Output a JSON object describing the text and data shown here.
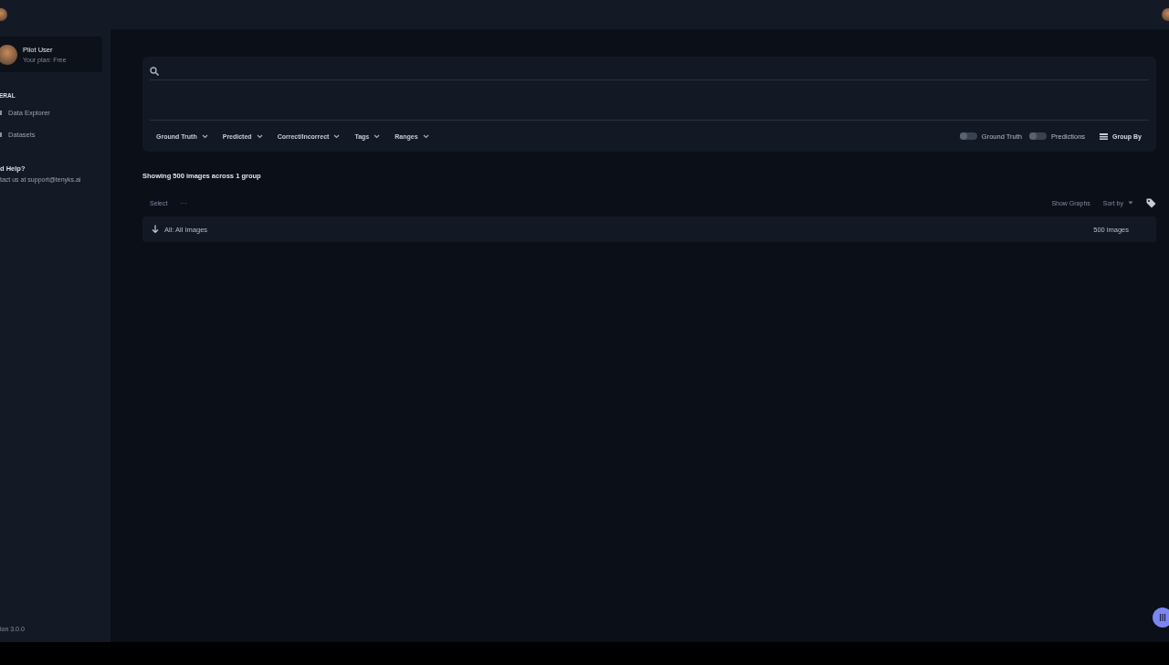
{
  "user": {
    "name": "Pilot User",
    "plan": "Your plan: Free"
  },
  "sidebar": {
    "section": "ERAL",
    "items": [
      {
        "label": "Data Explorer",
        "selected": false
      },
      {
        "label": "Datasets",
        "selected": false
      }
    ],
    "help_title": "d Help?",
    "help_text": "tact us at support@tenyks.ai",
    "version": "ion 3.0.0"
  },
  "filters": [
    {
      "label": "Ground Truth"
    },
    {
      "label": "Predicted"
    },
    {
      "label": "Correct/Incorrect"
    },
    {
      "label": "Tags"
    },
    {
      "label": "Ranges"
    }
  ],
  "toggles": [
    {
      "label": "Ground Truth",
      "on": false
    },
    {
      "label": "Predictions",
      "on": false
    }
  ],
  "group_by": "Group By",
  "summary": "Showing 500 images across 1 group",
  "select": "Select",
  "more": "···",
  "show_graphs": "Show Graphs",
  "sort_by": "Sort by",
  "groups": [
    {
      "name": "All: All Images",
      "count": "500 images"
    }
  ]
}
